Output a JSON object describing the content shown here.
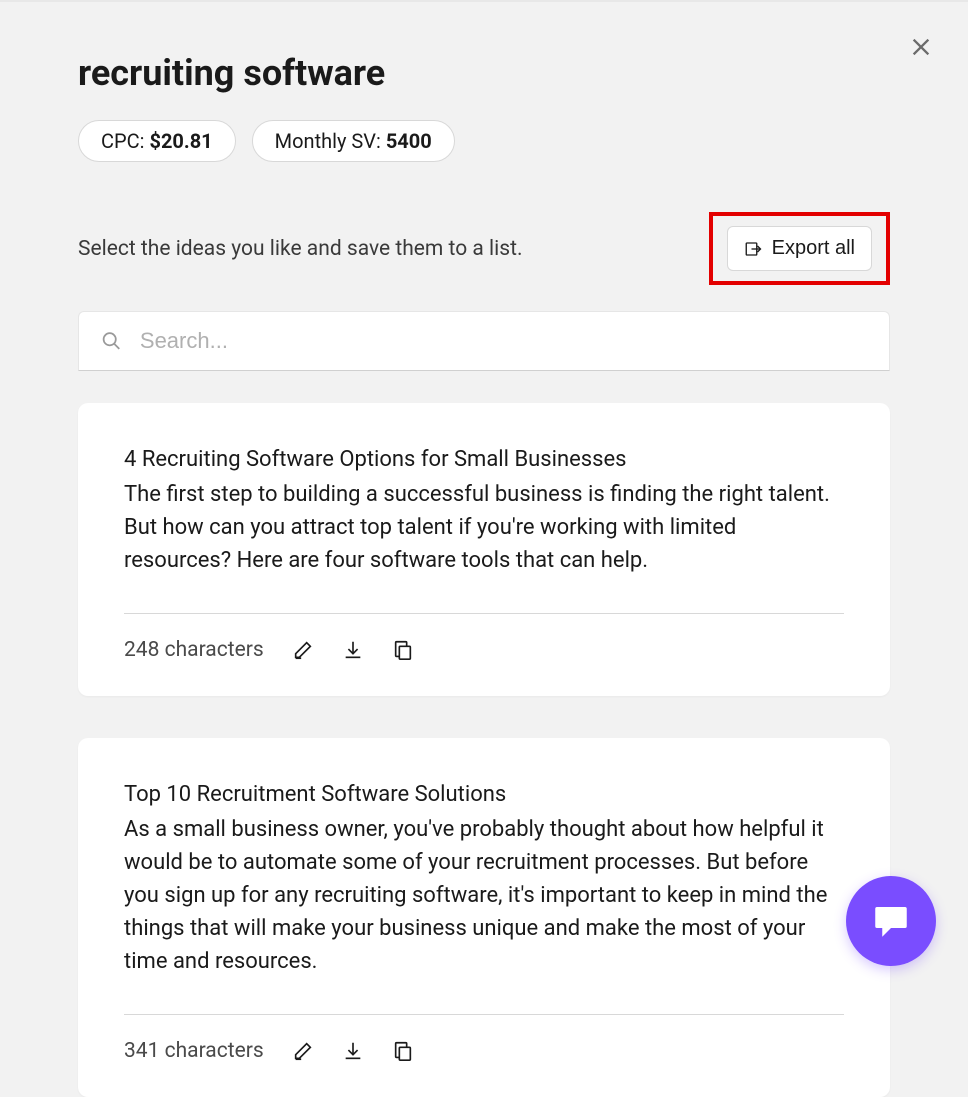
{
  "title": "recruiting software",
  "close_icon": "close",
  "metrics": {
    "cpc_label": "CPC: ",
    "cpc_value": "$20.81",
    "sv_label": "Monthly SV: ",
    "sv_value": "5400"
  },
  "instructions": "Select the ideas you like and save them to a list.",
  "export_label": "Export all",
  "search_placeholder": "Search...",
  "cards": [
    {
      "title": "4 Recruiting Software Options for Small Businesses",
      "body": "The first step to building a successful business is finding the right talent. But how can you attract top talent if you're working with limited resources? Here are four software tools that can help.",
      "char_count": "248 characters"
    },
    {
      "title": "Top 10 Recruitment Software Solutions",
      "body": "As a small business owner, you've probably thought about how helpful it would be to automate some of your recruitment processes. But before you sign up for any recruiting software, it's important to keep in mind the things that will make your business unique and make the most of your time and resources.",
      "char_count": "341 characters"
    }
  ]
}
